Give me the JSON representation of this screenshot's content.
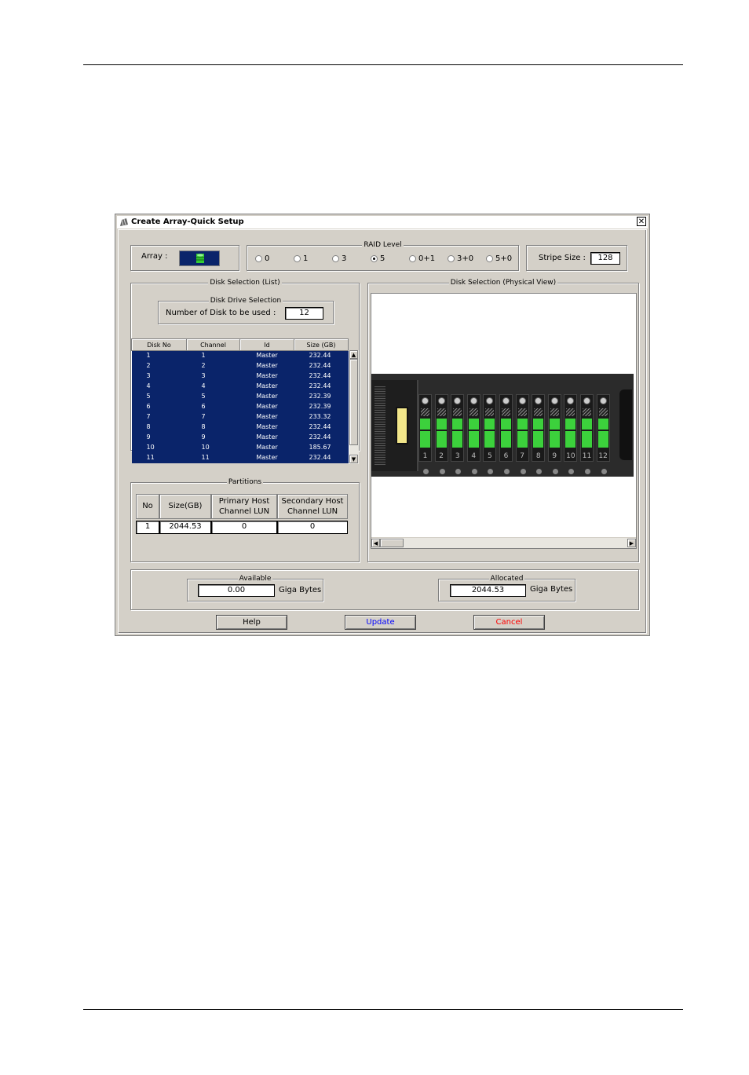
{
  "dialog": {
    "title": "Create Array-Quick Setup",
    "close_glyph": "✕",
    "app_icon": "array-app-icon"
  },
  "array": {
    "label": "Array :",
    "icon": "green-disk-array-icon",
    "icon_bg": "#0a246a",
    "icon_color": "#33cc33"
  },
  "raid": {
    "legend": "RAID Level",
    "options": [
      "0",
      "1",
      "3",
      "5",
      "0+1",
      "3+0",
      "5+0"
    ],
    "selected": "5"
  },
  "stripe": {
    "label": "Stripe Size :",
    "value": "128"
  },
  "disk_list": {
    "legend": "Disk Selection (List)",
    "drive_selection": {
      "legend": "Disk Drive Selection",
      "label": "Number of Disk to be used :",
      "value": "12"
    },
    "columns": [
      "Disk No",
      "Channel",
      "Id",
      "Size (GB)"
    ],
    "rows": [
      [
        "1",
        "1",
        "Master",
        "232.44"
      ],
      [
        "2",
        "2",
        "Master",
        "232.44"
      ],
      [
        "3",
        "3",
        "Master",
        "232.44"
      ],
      [
        "4",
        "4",
        "Master",
        "232.44"
      ],
      [
        "5",
        "5",
        "Master",
        "232.39"
      ],
      [
        "6",
        "6",
        "Master",
        "232.39"
      ],
      [
        "7",
        "7",
        "Master",
        "233.32"
      ],
      [
        "8",
        "8",
        "Master",
        "232.44"
      ],
      [
        "9",
        "9",
        "Master",
        "232.44"
      ],
      [
        "10",
        "10",
        "Master",
        "185.67"
      ],
      [
        "11",
        "11",
        "Master",
        "232.44"
      ]
    ],
    "selection_color": "#0a246a"
  },
  "physical_view": {
    "legend": "Disk Selection (Physical View)",
    "bays": [
      "1",
      "2",
      "3",
      "4",
      "5",
      "6",
      "7",
      "8",
      "9",
      "10",
      "11",
      "12"
    ],
    "bay_led_color": "#3cd13c"
  },
  "partitions": {
    "legend": "Partitions",
    "columns": [
      "No",
      "Size(GB)",
      "Primary Host Channel LUN",
      "Secondary Host Channel LUN"
    ],
    "rows": [
      [
        "1",
        "2044.53",
        "0",
        "0"
      ]
    ]
  },
  "available": {
    "legend": "Available",
    "value": "0.00",
    "unit": "Giga Bytes"
  },
  "allocated": {
    "legend": "Allocated",
    "value": "2044.53",
    "unit": "Giga Bytes"
  },
  "buttons": {
    "help": "Help",
    "update": "Update",
    "cancel": "Cancel",
    "update_color": "#0000ff",
    "cancel_color": "#ff0000"
  }
}
